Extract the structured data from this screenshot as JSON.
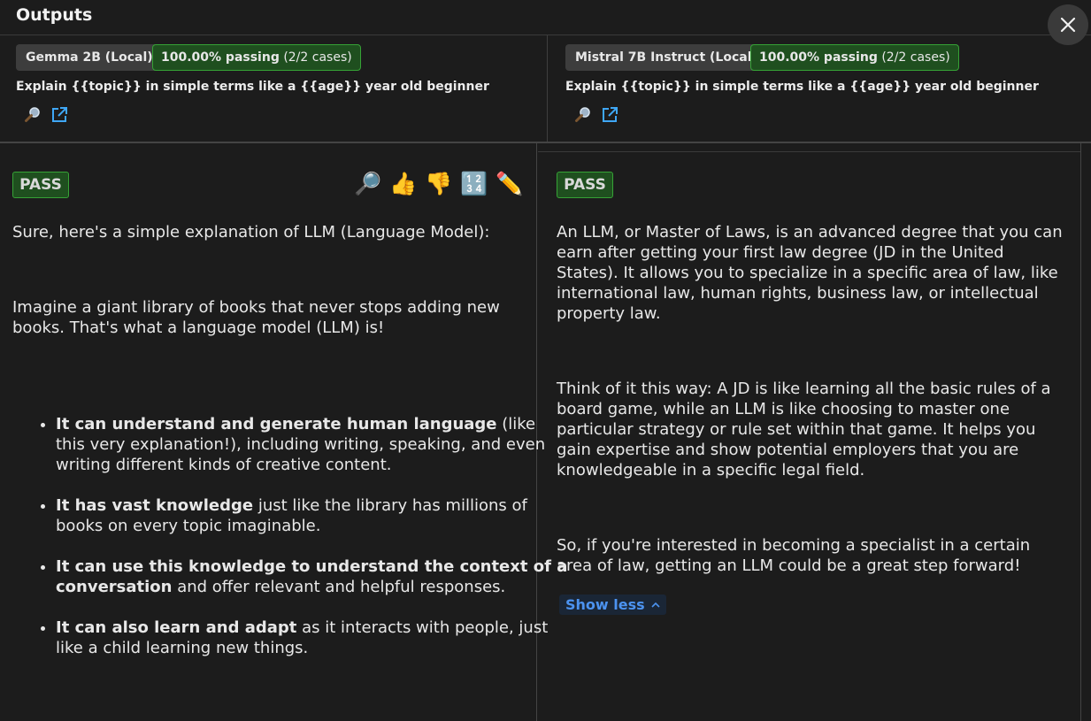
{
  "window": {
    "title": "Outputs"
  },
  "headers": [
    {
      "model": "Gemma 2B (Local)",
      "pass_pct": "100.00% passing",
      "pass_cases": "(2/2 cases)",
      "prompt": "Explain {{topic}} in simple terms like a {{age}} year old beginner"
    },
    {
      "model": "Mistral 7B Instruct (Local)",
      "pass_pct": "100.00% passing",
      "pass_cases": "(2/2 cases)",
      "prompt": "Explain {{topic}} in simple terms like a {{age}} year old beginner"
    }
  ],
  "outputs": [
    {
      "status": "PASS",
      "actions": [
        "🔎",
        "👍",
        "👎",
        "🔢",
        "✏️"
      ],
      "para1": "Sure, here's a simple explanation of LLM (Language Model):",
      "para2": "Imagine a giant library of books that never stops adding new books. That's what a language model (LLM) is!",
      "bullets": [
        {
          "bold": "It can understand and generate human language",
          "rest": " (like this very explanation!), including writing, speaking, and even writing different kinds of creative content."
        },
        {
          "bold": "It has vast knowledge",
          "rest": " just like the library has millions of books on every topic imaginable."
        },
        {
          "bold": "It can use this knowledge to understand the context of a conversation",
          "rest": " and offer relevant and helpful responses."
        },
        {
          "bold": "It can also learn and adapt",
          "rest": " as it interacts with people, just like a child learning new things."
        }
      ]
    },
    {
      "status": "PASS",
      "para1": "An LLM, or Master of Laws, is an advanced degree that you can earn after getting your first law degree (JD in the United States). It allows you to specialize in a specific area of law, like international law, human rights, business law, or intellectual property law.",
      "para2": "Think of it this way: A JD is like learning all the basic rules of a board game, while an LLM is like choosing to master one particular strategy or rule set within that game. It helps you gain expertise and show potential employers that you are knowledgeable in a specific legal field.",
      "para3": "So, if you're interested in becoming a specialist in a certain area of law, getting an LLM could be a great step forward!",
      "show_less": "Show less"
    }
  ],
  "colors": {
    "pass_border": "#36a236",
    "pass_bg": "#1f4f1f",
    "link": "#4c93f0",
    "icon_blue": "#3fa7f5"
  }
}
